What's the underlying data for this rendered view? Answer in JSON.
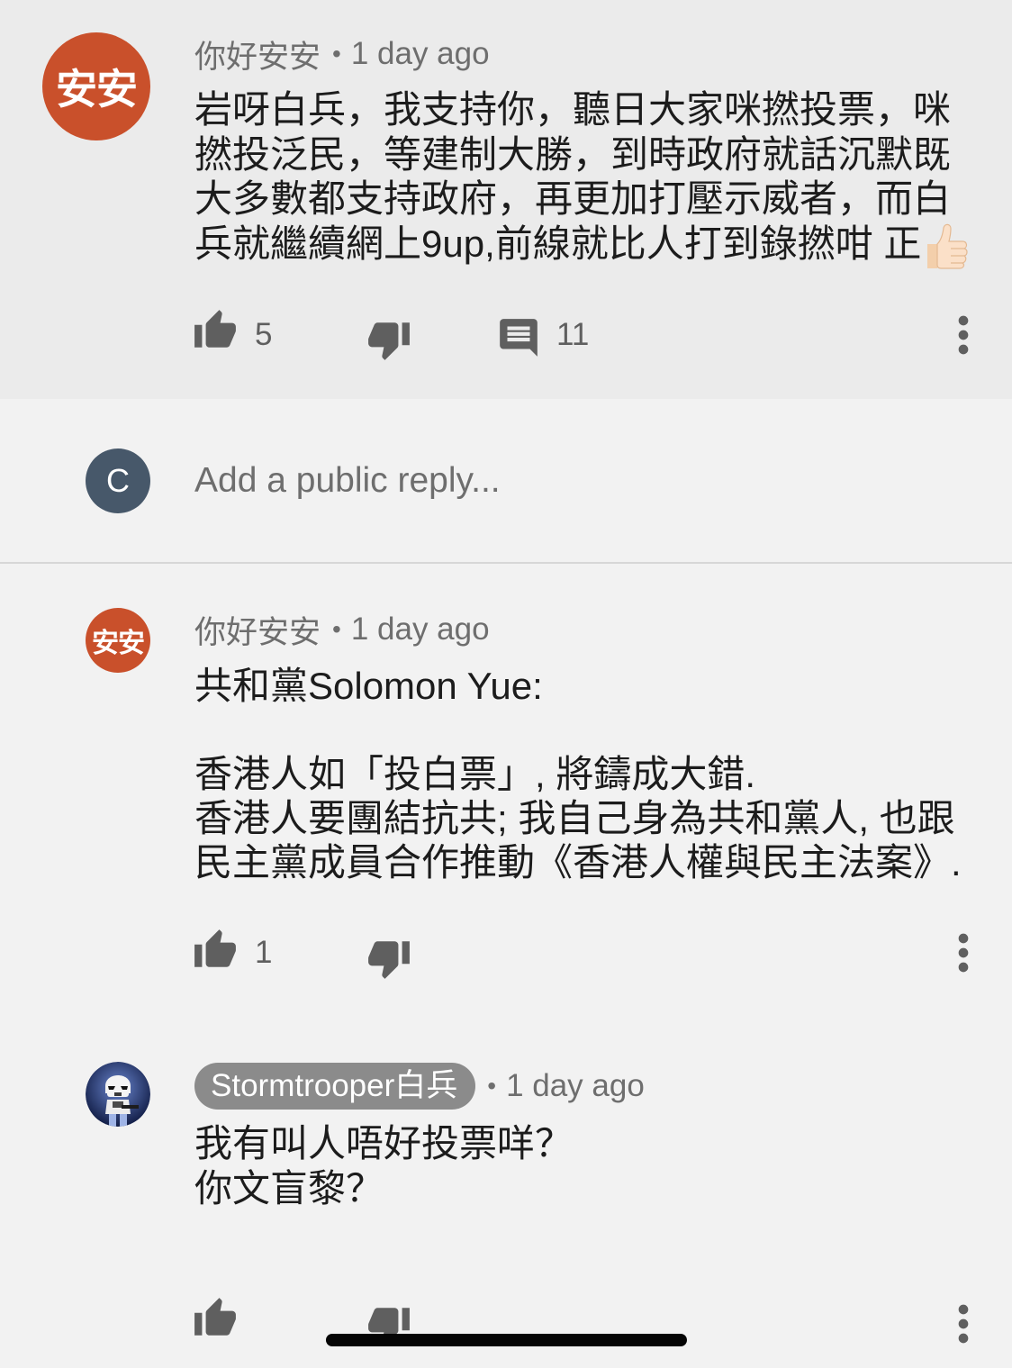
{
  "top_comment": {
    "avatar_text": "安安",
    "author": "你好安安",
    "separator": "•",
    "time": "1 day ago",
    "text_lines": [
      "岩呀白兵，我支持你，聽日大家咪撚投票，咪",
      "撚投泛民，等建制大勝，到時政府就話沉默既",
      "大多數都支持政府，再更加打壓示威者，而白",
      "兵就繼續網上9up,前線就比人打到錄撚咁 正"
    ],
    "trailing_emoji": "thumbs-up-light-skin-tone-emoji",
    "like_count": "5",
    "reply_count": "11"
  },
  "reply_box": {
    "avatar_letter": "C",
    "placeholder": "Add a public reply..."
  },
  "replies": [
    {
      "avatar_text": "安安",
      "author": "你好安安",
      "separator": "•",
      "time": "1 day ago",
      "text_lines": [
        "共和黨Solomon Yue:",
        "香港人如「投白票」, 將鑄成大錯.",
        "香港人要團結抗共; 我自己身為共和黨人, 也跟",
        "民主黨成員合作推動《香港人權與民主法案》."
      ],
      "like_count": "1"
    },
    {
      "avatar": "stormtrooper-avatar",
      "author": "Stormtrooper白兵",
      "separator": "•",
      "time": "1 day ago",
      "text_lines": [
        "我有叫人唔好投票咩？",
        "你文盲黎？"
      ]
    }
  ],
  "icons": {
    "like": "thumb-up-icon",
    "dislike": "thumb-down-icon",
    "reply": "comment-icon",
    "more": "more-vert-icon"
  },
  "colors": {
    "highlight_background": "#ebebeb",
    "page_background": "#f2f2f2",
    "primary_text": "#1c1c1c",
    "secondary_text": "#6e6e6e",
    "icon": "#5f5f5f",
    "avatar_anan": "#c9502b",
    "avatar_c": "#47586a",
    "author_chip": "#8b8b8b"
  }
}
